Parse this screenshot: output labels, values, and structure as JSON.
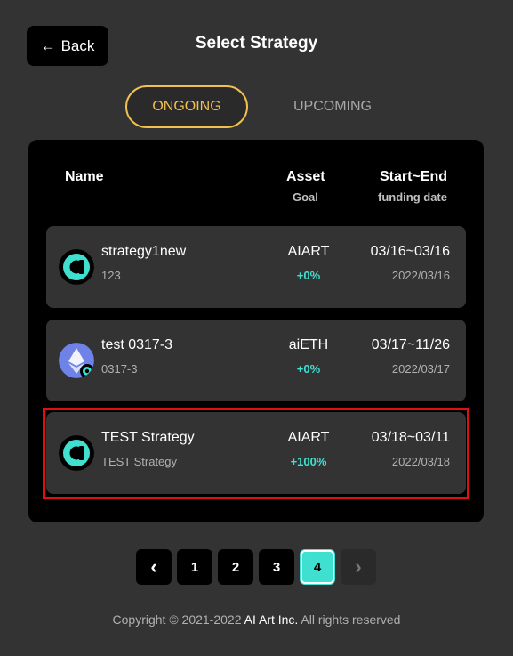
{
  "header": {
    "back_label": "Back",
    "title": "Select Strategy"
  },
  "tabs": [
    {
      "label": "ONGOING",
      "active": true
    },
    {
      "label": "UPCOMING",
      "active": false
    }
  ],
  "table": {
    "col_name": "Name",
    "col_asset": "Asset",
    "col_asset_sub": "Goal",
    "col_dates": "Start~End",
    "col_dates_sub": "funding date",
    "rows": [
      {
        "name": "strategy1new",
        "sub": "123",
        "asset": "AIART",
        "goal": "+0%",
        "range": "03/16~03/16",
        "funding_date": "2022/03/16",
        "icon": "aiart-logo-icon"
      },
      {
        "name": "test 0317-3",
        "sub": "0317-3",
        "asset": "aiETH",
        "goal": "+0%",
        "range": "03/17~11/26",
        "funding_date": "2022/03/17",
        "icon": "aieth-logo-icon"
      },
      {
        "name": "TEST Strategy",
        "sub": "TEST Strategy",
        "asset": "AIART",
        "goal": "+100%",
        "range": "03/18~03/11",
        "funding_date": "2022/03/18",
        "icon": "aiart-logo-icon"
      }
    ]
  },
  "pagination": {
    "prev": "‹",
    "pages": [
      "1",
      "2",
      "3",
      "4"
    ],
    "current": "4",
    "next": "›"
  },
  "footer": {
    "prefix": "Copyright © 2021-2022 ",
    "brand": "AI Art Inc.",
    "suffix": " All rights reserved"
  },
  "colors": {
    "accent": "#3fe0d0",
    "tab_active": "#f0c050",
    "highlight": "#e01010"
  }
}
